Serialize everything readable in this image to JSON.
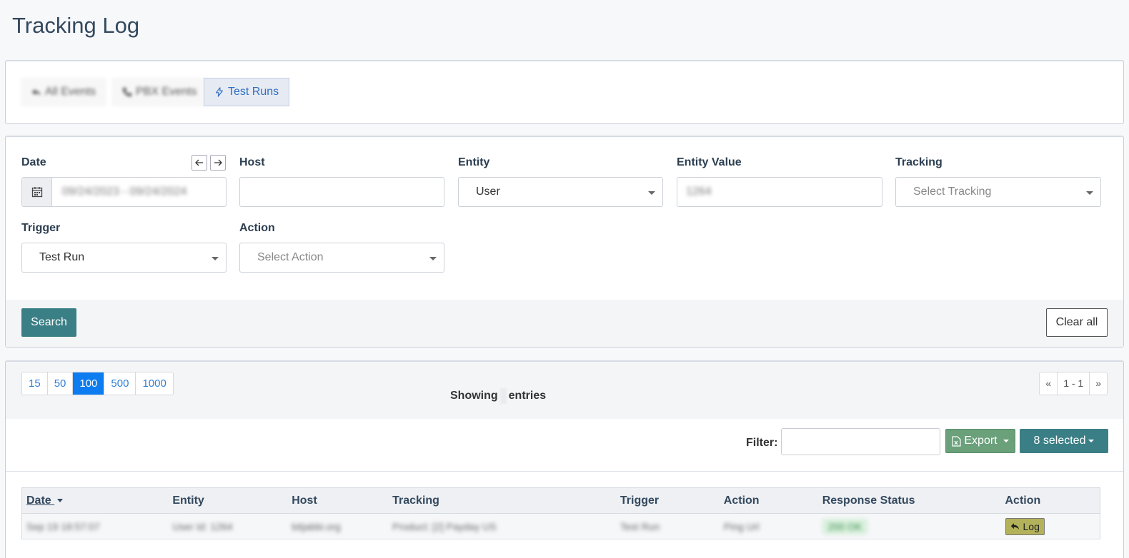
{
  "page": {
    "title": "Tracking Log"
  },
  "tabs": [
    {
      "label": "All Events",
      "icon": "reply-icon",
      "blurred": true
    },
    {
      "label": "PBX Events",
      "icon": "phone-icon",
      "blurred": true
    },
    {
      "label": "Test Runs",
      "icon": "bolt-icon",
      "active": true
    }
  ],
  "filters": {
    "date": {
      "label": "Date",
      "value": "09/24/2023 - 09/24/2024"
    },
    "host": {
      "label": "Host",
      "value": ""
    },
    "entity": {
      "label": "Entity",
      "value": "User"
    },
    "entity_value": {
      "label": "Entity Value",
      "value": "1264"
    },
    "tracking": {
      "label": "Tracking",
      "placeholder": "Select Tracking"
    },
    "trigger": {
      "label": "Trigger",
      "value": "Test Run"
    },
    "action": {
      "label": "Action",
      "placeholder": "Select Action"
    },
    "search_label": "Search",
    "clear_label": "Clear all"
  },
  "results": {
    "page_sizes": [
      "15",
      "50",
      "100",
      "500",
      "1000"
    ],
    "active_page_size": "100",
    "showing_prefix": "Showing",
    "showing_suffix": "entries",
    "pager": {
      "prev": "«",
      "range": "1 - 1",
      "next": "»"
    },
    "filter_label": "Filter:",
    "export_label": "Export",
    "selected_label": "8 selected"
  },
  "table": {
    "columns": [
      "Date",
      "Entity",
      "Host",
      "Tracking",
      "Trigger",
      "Action",
      "Response Status",
      "Action"
    ],
    "rows": [
      {
        "date": "Sep 19 18:57:07",
        "entity": "User Id: 1264",
        "host": "bitjabbi.org",
        "tracking": "Product: [2] Payday US",
        "trigger": "Test Run",
        "action": "Ping Url",
        "status": "200 OK",
        "log_label": "Log"
      }
    ]
  },
  "colors": {
    "primary": "#3b7f86",
    "export": "#6aa07a",
    "page_active": "#0d7cf0",
    "log_button": "#b3b25b"
  }
}
